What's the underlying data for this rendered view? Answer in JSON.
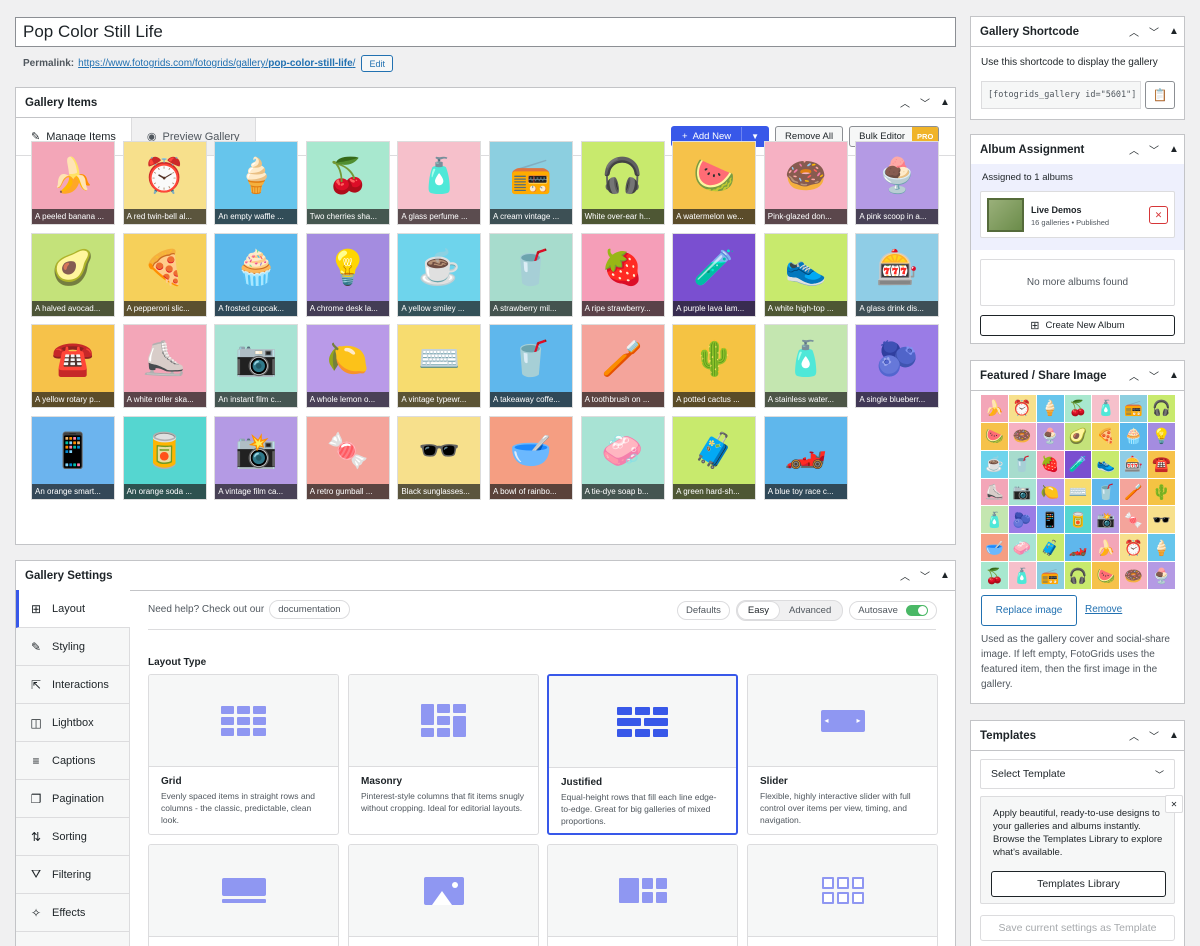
{
  "post_title": "Pop Color Still Life",
  "permalink": {
    "label": "Permalink:",
    "base": "https://www.fotogrids.com/fotogrids/gallery/",
    "slug": "pop-color-still-life",
    "trail": "/",
    "edit": "Edit"
  },
  "gallery_items": {
    "title": "Gallery Items",
    "tabs": {
      "manage": "Manage Items",
      "preview": "Preview Gallery"
    },
    "add_new": "Add New",
    "remove_all": "Remove All",
    "bulk_editor": "Bulk Editor",
    "pro": "PRO",
    "items": [
      {
        "caption": "A peeled banana ...",
        "bg": "#f3a6b8",
        "glyph": "🍌"
      },
      {
        "caption": "A red twin-bell al...",
        "bg": "#f7e08c",
        "glyph": "⏰"
      },
      {
        "caption": "An empty waffle ...",
        "bg": "#66c5ec",
        "glyph": "🍦"
      },
      {
        "caption": "Two cherries sha...",
        "bg": "#a8e8cf",
        "glyph": "🍒"
      },
      {
        "caption": "A glass perfume ...",
        "bg": "#f6c0cb",
        "glyph": "🧴"
      },
      {
        "caption": "A cream vintage ...",
        "bg": "#8ccfe0",
        "glyph": "📻"
      },
      {
        "caption": "White over-ear h...",
        "bg": "#c8ea6d",
        "glyph": "🎧"
      },
      {
        "caption": "A watermelon we...",
        "bg": "#f6c24a",
        "glyph": "🍉"
      },
      {
        "caption": "Pink-glazed don...",
        "bg": "#f6b1c3",
        "glyph": "🍩"
      },
      {
        "caption": "A pink scoop in a...",
        "bg": "#b49ae4",
        "glyph": "🍨"
      },
      {
        "caption": "A halved avocad...",
        "bg": "#c4e27a",
        "glyph": "🥑"
      },
      {
        "caption": "A pepperoni slic...",
        "bg": "#f6d05a",
        "glyph": "🍕"
      },
      {
        "caption": "A frosted cupcak...",
        "bg": "#5ab8ec",
        "glyph": "🧁"
      },
      {
        "caption": "A chrome desk la...",
        "bg": "#a48ce0",
        "glyph": "💡"
      },
      {
        "caption": "A yellow smiley ...",
        "bg": "#6ed4ec",
        "glyph": "☕"
      },
      {
        "caption": "A strawberry mil...",
        "bg": "#a7dccd",
        "glyph": "🥤"
      },
      {
        "caption": "A ripe strawberry...",
        "bg": "#f59eb8",
        "glyph": "🍓"
      },
      {
        "caption": "A purple lava lam...",
        "bg": "#7a4fd0",
        "glyph": "🧪"
      },
      {
        "caption": "A white high-top ...",
        "bg": "#c8ea6d",
        "glyph": "👟"
      },
      {
        "caption": "A glass drink dis...",
        "bg": "#8fcde6",
        "glyph": "🎰"
      },
      {
        "caption": "A yellow rotary p...",
        "bg": "#f6c24a",
        "glyph": "☎️"
      },
      {
        "caption": "A white roller ska...",
        "bg": "#f3a6b8",
        "glyph": "⛸️"
      },
      {
        "caption": "An instant film c...",
        "bg": "#a8e3d4",
        "glyph": "📷"
      },
      {
        "caption": "A whole lemon o...",
        "bg": "#b99ae8",
        "glyph": "🍋"
      },
      {
        "caption": "A vintage typewr...",
        "bg": "#f7dc6f",
        "glyph": "⌨️"
      },
      {
        "caption": "A takeaway coffe...",
        "bg": "#5fb7ec",
        "glyph": "🥤"
      },
      {
        "caption": "A toothbrush on ...",
        "bg": "#f4a49b",
        "glyph": "🪥"
      },
      {
        "caption": "A potted cactus ...",
        "bg": "#f5c343",
        "glyph": "🌵"
      },
      {
        "caption": "A stainless water...",
        "bg": "#c4e6b0",
        "glyph": "🧴"
      },
      {
        "caption": "A single blueberr...",
        "bg": "#9a7ce6",
        "glyph": "🫐"
      },
      {
        "caption": "An orange smart...",
        "bg": "#6cb4ee",
        "glyph": "📱"
      },
      {
        "caption": "An orange soda ...",
        "bg": "#55d6d0",
        "glyph": "🥫"
      },
      {
        "caption": "A vintage film ca...",
        "bg": "#b49ae4",
        "glyph": "📸"
      },
      {
        "caption": "A retro gumball ...",
        "bg": "#f4a49b",
        "glyph": "🍬"
      },
      {
        "caption": "Black sunglasses...",
        "bg": "#f7e08c",
        "glyph": "🕶️"
      },
      {
        "caption": "A bowl of rainbo...",
        "bg": "#f59e82",
        "glyph": "🥣"
      },
      {
        "caption": "A tie-dye soap b...",
        "bg": "#a8e3d4",
        "glyph": "🧼"
      },
      {
        "caption": "A green hard-sh...",
        "bg": "#c8ea6d",
        "glyph": "🧳"
      },
      {
        "caption": "A blue toy race c...",
        "bg": "#5fb7ec",
        "glyph": "🏎️"
      }
    ]
  },
  "gallery_settings": {
    "title": "Gallery Settings",
    "help_text": "Need help? Check out our",
    "documentation": "documentation",
    "defaults": "Defaults",
    "easy": "Easy",
    "advanced": "Advanced",
    "autosave": "Autosave",
    "nav": [
      {
        "label": "Layout",
        "icon": "grid-icon",
        "glyph": "⊞"
      },
      {
        "label": "Styling",
        "icon": "brush-icon",
        "glyph": "✎"
      },
      {
        "label": "Interactions",
        "icon": "pointer-icon",
        "glyph": "⇱"
      },
      {
        "label": "Lightbox",
        "icon": "lightbox-icon",
        "glyph": "◫"
      },
      {
        "label": "Captions",
        "icon": "captions-icon",
        "glyph": "≡"
      },
      {
        "label": "Pagination",
        "icon": "pages-icon",
        "glyph": "❐"
      },
      {
        "label": "Sorting",
        "icon": "sort-icon",
        "glyph": "⇅"
      },
      {
        "label": "Filtering",
        "icon": "filter-icon",
        "glyph": "⛛"
      },
      {
        "label": "Effects",
        "icon": "sparkle-icon",
        "glyph": "✧"
      }
    ],
    "layout_type_label": "Layout Type",
    "layouts": [
      {
        "name": "Grid",
        "desc": "Evenly spaced items in straight rows and columns - the classic, predictable, clean look."
      },
      {
        "name": "Masonry",
        "desc": "Pinterest-style columns that fit items snugly without cropping. Ideal for editorial layouts."
      },
      {
        "name": "Justified",
        "desc": "Equal-height rows that fill each line edge-to-edge. Great for big galleries of mixed proportions."
      },
      {
        "name": "Slider",
        "desc": "Flexible, highly interactive slider with full control over items per view, timing, and navigation."
      }
    ]
  },
  "shortcode": {
    "title": "Gallery Shortcode",
    "help": "Use this shortcode to display the gallery",
    "value": "[fotogrids_gallery id=\"5601\"]"
  },
  "album": {
    "title": "Album Assignment",
    "assigned": "Assigned to 1 albums",
    "album_name": "Live Demos",
    "album_meta": "16 galleries • Published",
    "empty": "No more albums found",
    "create": "Create New Album"
  },
  "featured": {
    "title": "Featured / Share Image",
    "replace": "Replace image",
    "remove": "Remove",
    "help": "Used as the gallery cover and social-share image. If left empty, FotoGrids uses the featured item, then the first image in the gallery."
  },
  "templates": {
    "title": "Templates",
    "select": "Select Template",
    "info": "Apply beautiful, ready-to-use designs to your galleries and albums instantly. Browse the Templates Library to explore what's available.",
    "library": "Templates Library",
    "save": "Save current settings as Template"
  },
  "colors": {
    "accent": "#3858e9",
    "pro": "#f0b429",
    "danger": "#d63638",
    "toggle": "#4ab866"
  }
}
